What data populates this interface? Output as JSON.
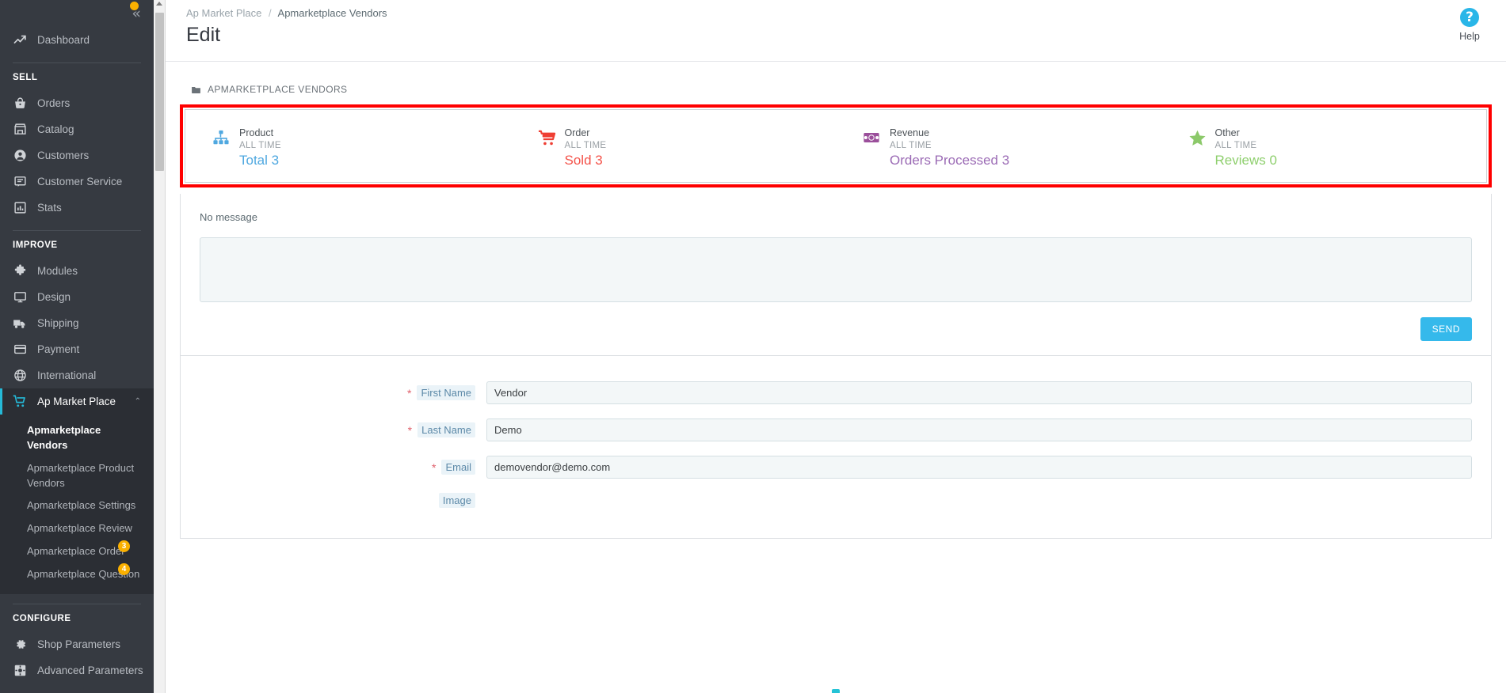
{
  "sidebar": {
    "collapse_label": "«",
    "dashboard": {
      "label": "Dashboard",
      "icon": "trending-up-icon"
    },
    "sections": [
      {
        "title": "SELL",
        "items": [
          {
            "label": "Orders",
            "icon": "basket-icon"
          },
          {
            "label": "Catalog",
            "icon": "store-icon"
          },
          {
            "label": "Customers",
            "icon": "person-icon"
          },
          {
            "label": "Customer Service",
            "icon": "chat-icon"
          },
          {
            "label": "Stats",
            "icon": "bar-chart-icon"
          }
        ]
      },
      {
        "title": "IMPROVE",
        "items": [
          {
            "label": "Modules",
            "icon": "puzzle-icon"
          },
          {
            "label": "Design",
            "icon": "monitor-icon"
          },
          {
            "label": "Shipping",
            "icon": "truck-icon"
          },
          {
            "label": "Payment",
            "icon": "credit-card-icon"
          },
          {
            "label": "International",
            "icon": "globe-icon"
          },
          {
            "label": "Ap Market Place",
            "icon": "cart-icon",
            "active": true,
            "caret": "⌃"
          }
        ]
      },
      {
        "title": "CONFIGURE",
        "items": [
          {
            "label": "Shop Parameters",
            "icon": "gear-icon"
          },
          {
            "label": "Advanced Parameters",
            "icon": "gear-box-icon"
          }
        ]
      }
    ],
    "submenu": [
      {
        "label": "Apmarketplace Vendors",
        "active": true
      },
      {
        "label": "Apmarketplace Product Vendors"
      },
      {
        "label": "Apmarketplace Settings"
      },
      {
        "label": "Apmarketplace Review"
      },
      {
        "label": "Apmarketplace Order",
        "badge": "3"
      },
      {
        "label": "Apmarketplace Question",
        "badge": "4"
      }
    ]
  },
  "header": {
    "breadcrumb_parent": "Ap Market Place",
    "breadcrumb_sep": "/",
    "breadcrumb_current": "Apmarketplace Vendors",
    "title": "Edit",
    "help_glyph": "?",
    "help_label": "Help"
  },
  "panel": {
    "title": "APMARKETPLACE VENDORS"
  },
  "stats": [
    {
      "icon": "sitemap-icon",
      "icon_color": "#4fa8e0",
      "label": "Product",
      "period": "ALL TIME",
      "value": "Total 3",
      "value_color": "#4fa8e0"
    },
    {
      "icon": "shopping-cart-icon",
      "icon_color": "#ef3e33",
      "label": "Order",
      "period": "ALL TIME",
      "value": "Sold 3",
      "value_color": "#f4534a"
    },
    {
      "icon": "money-bill-icon",
      "icon_color": "#9b4f9b",
      "label": "Revenue",
      "period": "ALL TIME",
      "value": "Orders Processed 3",
      "value_color": "#9b6bb5"
    },
    {
      "icon": "star-icon",
      "icon_color": "#8cc96a",
      "label": "Other",
      "period": "ALL TIME",
      "value": "Reviews 0",
      "value_color": "#8ecf6d"
    }
  ],
  "message": {
    "no_message": "No message",
    "textarea_value": "",
    "textarea_placeholder": "",
    "send_label": "SEND"
  },
  "form": {
    "fields": [
      {
        "required": true,
        "label": "First Name",
        "value": "Vendor"
      },
      {
        "required": true,
        "label": "Last Name",
        "value": "Demo"
      },
      {
        "required": true,
        "label": "Email",
        "value": "demovendor@demo.com"
      }
    ],
    "image_label": "Image"
  },
  "colors": {
    "accent": "#25b9d7",
    "highlight_box": "#ff0000",
    "send_button": "#35b9eb",
    "badge": "#fab000",
    "sidebar_bg": "#363a41"
  }
}
